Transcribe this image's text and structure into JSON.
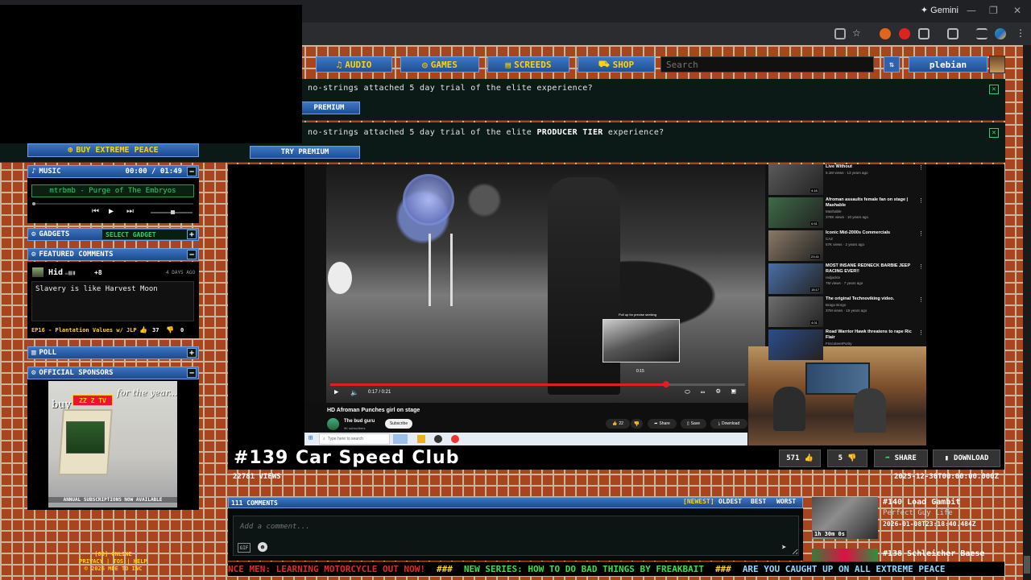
{
  "browser": {
    "gemini_label": "Gemini"
  },
  "nav": {
    "items": [
      {
        "label": "AUDIO",
        "icon": "music-note-icon"
      },
      {
        "label": "GAMES",
        "icon": "gamepad-icon"
      },
      {
        "label": "SCREEDS",
        "icon": "newspaper-icon"
      },
      {
        "label": "SHOP",
        "icon": "cart-icon"
      }
    ],
    "search_placeholder": "Search",
    "username": "plebian"
  },
  "promos": [
    {
      "text": "no-strings attached 5 day trial of the elite experience?",
      "button": "PREMIUM"
    },
    {
      "text_before": "no-strings attached 5 day trial of the elite ",
      "text_bold": "PRODUCER TIER",
      "text_after": " experience?",
      "button": "TRY PREMIUM"
    }
  ],
  "sidebar": {
    "buy_button": "BUY EXTREME PEACE",
    "music": {
      "title": "MUSIC",
      "time": "00:00 / 01:49",
      "track": "mtrbmb - Purge of The Embryos"
    },
    "gadgets": {
      "title": "GADGETS",
      "select": "SELECT GADGET"
    },
    "featured": {
      "title": "FEATURED COMMENTS",
      "user": "Hid",
      "badge_count": "+8",
      "age": "4 DAYS AGO",
      "text": "Slavery is like Harvest Moon",
      "episode": "EP16 - Plantation Values w/ JLP",
      "likes": "37",
      "dislikes": "0"
    },
    "poll": {
      "title": "POLL"
    },
    "sponsors": {
      "title": "OFFICIAL SPONSORS",
      "ad_text": "buy",
      "ad_script": "for the year...",
      "caption": "ANNUAL SUBSCRIPTIONS NOW AVAILABLE"
    },
    "footer": {
      "online": "[88] ONLINE",
      "links": "PRIVACY | TOS | HELP",
      "copyright": "© 2026 MDE TO INC"
    }
  },
  "video": {
    "yt_title": "HD Afroman Punches girl on stage",
    "yt_channel": "The bud guru",
    "yt_subs": "9K subscribers",
    "yt_subscribe": "Subscribe",
    "yt_time": "0:17 / 0:21",
    "yt_likes": "22",
    "yt_share": "Share",
    "yt_save": "Save",
    "yt_download": "Download",
    "seek_hint": "Pull up for precise seeking",
    "seek_time": "0:15",
    "taskbar_search": "Type here to search",
    "progress": 0.81,
    "recommended": [
      {
        "title": "Live Without",
        "meta": "5.1M views · 13 years ago",
        "dur": "4:18",
        "color": "#5a5a5a"
      },
      {
        "title": "Afroman assaults female fan on stage | Mashable",
        "channel": "Mashable",
        "meta": "378K views · 10 years ago",
        "dur": "0:51",
        "color": "#3e6b47"
      },
      {
        "title": "Iconic Mid-2000s Commercials",
        "channel": "CAZ",
        "meta": "57K views · 2 years ago",
        "dur": "23:41",
        "color": "#8a7a66"
      },
      {
        "title": "MOST INSANE REDNECK BARBIE JEEP RACING EVER!!",
        "channel": "redjacktv",
        "meta": "7M views · 7 years ago",
        "dur": "15:17",
        "color": "#4a6fa8"
      },
      {
        "title": "The original Technoviking video.",
        "channel": "Brago Borgo",
        "meta": "37M views · 15 years ago",
        "dur": "4:01",
        "color": "#6e6e6e"
      },
      {
        "title": "Road Warrior Hawk threatens to rape Ric Flair",
        "channel": "FriscoteenPurity",
        "meta": "",
        "dur": "",
        "color": "#2c4d8c"
      }
    ]
  },
  "episode": {
    "title": "#139 Car Speed Club",
    "views": "22781 VIEWS",
    "date": "2025-12-30T00:00:00.000Z",
    "likes": "571",
    "dislikes": "5",
    "share": "SHARE",
    "download": "DOWNLOAD"
  },
  "comments": {
    "header": "111 COMMENTS",
    "sorts": [
      "[NEWEST]",
      "OLDEST",
      "BEST",
      "WORST"
    ],
    "placeholder": "Add a comment...",
    "gif": "GIF"
  },
  "related": [
    {
      "title": "#140 Load Gambit",
      "subtitle": "Perfect Guy Life",
      "date": "2026-01-08T23:18:40.484Z",
      "duration": "1h 30m 0s"
    },
    {
      "title": "#138 Schleicher Baese",
      "subtitle": "",
      "date": "",
      "duration": ""
    }
  ],
  "ticker": [
    {
      "text": "NCE MEN: LEARNING MOTORCYCLE OUT NOW!",
      "color": "red"
    },
    {
      "text": "###",
      "color": "yellow"
    },
    {
      "text": "NEW SERIES: HOW TO DO BAD THINGS BY FREAKBAIT",
      "color": "green"
    },
    {
      "text": "###",
      "color": "yellow"
    },
    {
      "text": "ARE YOU CAUGHT UP ON ALL EXTREME PEACE",
      "color": "cyan"
    }
  ]
}
